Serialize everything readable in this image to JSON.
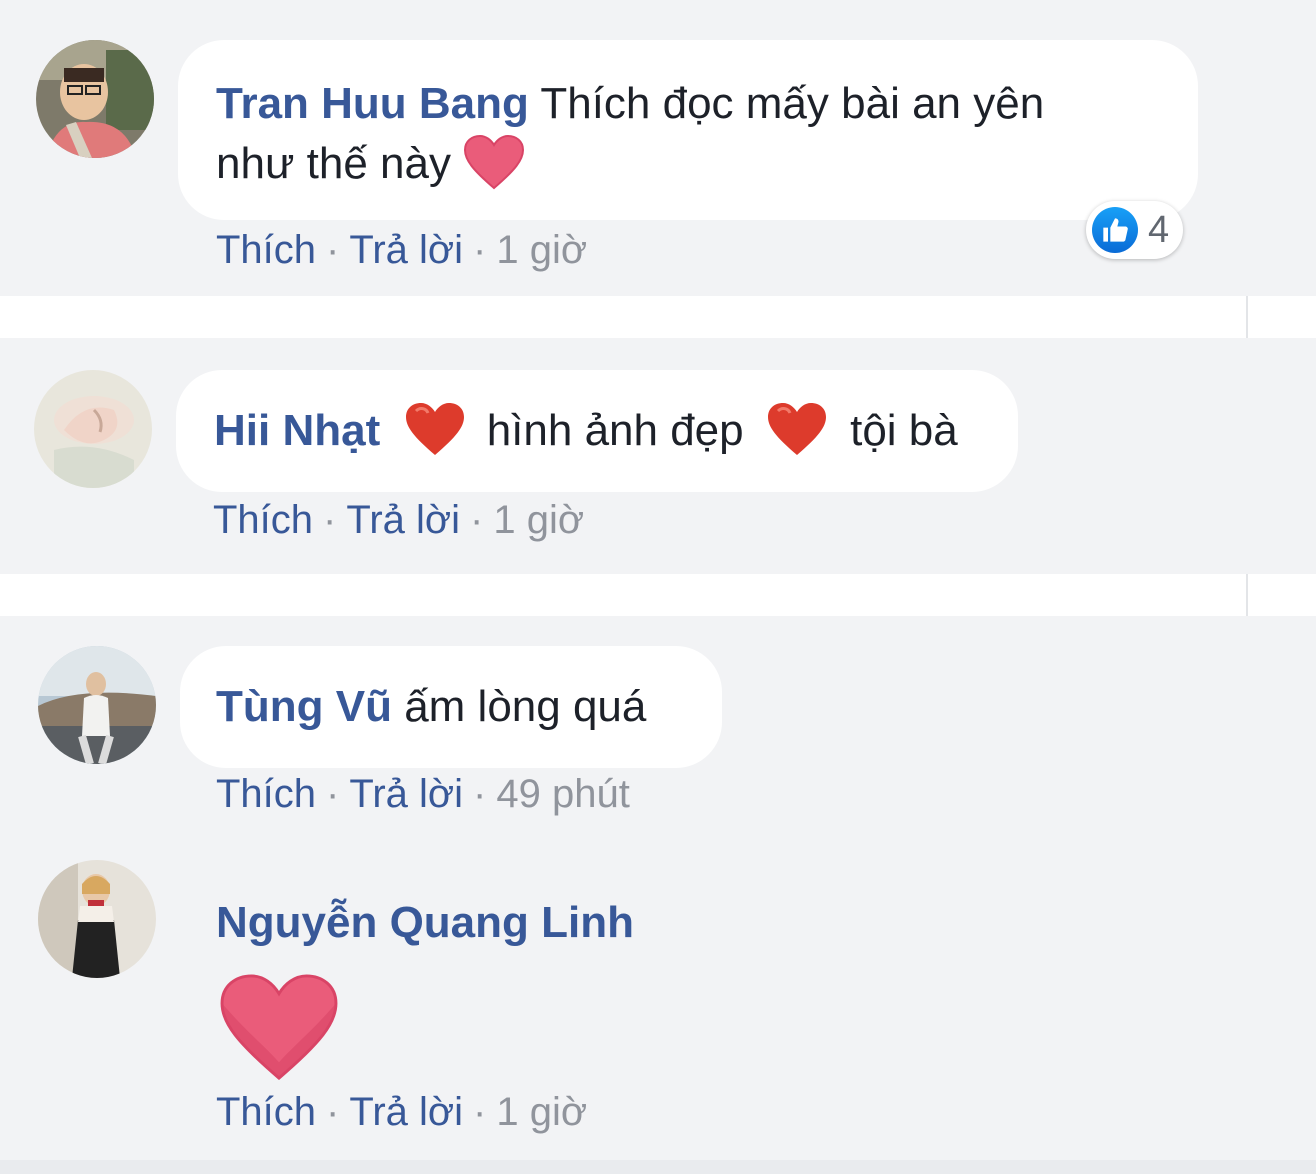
{
  "comments": [
    {
      "author": "Tran Huu Bang",
      "text_line1": "Thích đọc mấy bài an yên",
      "text_line2": "như thế này",
      "like_label": "Thích",
      "reply_label": "Trả lời",
      "time": "1 giờ",
      "reaction_count": "4"
    },
    {
      "author": "Hii Nhạt",
      "text_part1": "hình ảnh đẹp",
      "text_part2": "tội bà",
      "like_label": "Thích",
      "reply_label": "Trả lời",
      "time": "1 giờ"
    },
    {
      "author": "Tùng Vũ",
      "text": "ấm lòng quá",
      "like_label": "Thích",
      "reply_label": "Trả lời",
      "time": "49 phút"
    },
    {
      "author": "Nguyễn Quang Linh",
      "like_label": "Thích",
      "reply_label": "Trả lời",
      "time": "1 giờ"
    }
  ],
  "separator": "·",
  "colors": {
    "name": "#385898",
    "background": "#f2f3f5",
    "like_blue": "#1877f2",
    "heart_pink": "#e9506e",
    "heart_red": "#dd3b2c"
  },
  "icons": [
    "like-reaction-icon",
    "pink-heart-emoji",
    "red-heart-emoji"
  ]
}
